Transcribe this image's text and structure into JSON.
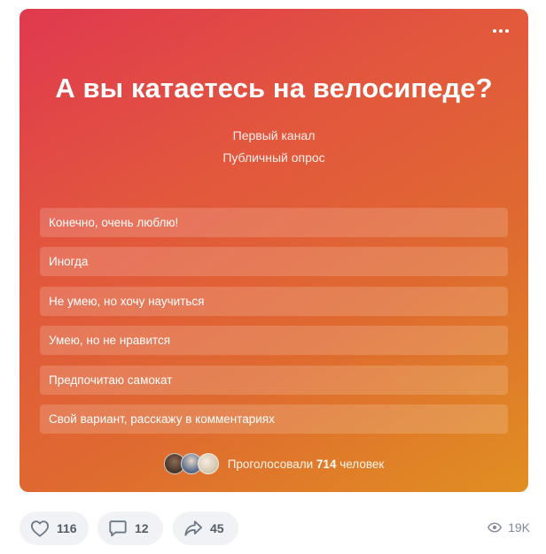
{
  "poll": {
    "title": "А вы катаетесь на велосипеде?",
    "author": "Первый канал",
    "type": "Публичный опрос",
    "options": [
      "Конечно, очень люблю!",
      "Иногда",
      "Не умею, но хочу научиться",
      "Умею, но не нравится",
      "Предпочитаю самокат",
      "Свой вариант, расскажу в комментариях"
    ],
    "voted_prefix": "Проголосовали",
    "voted_count": "714",
    "voted_suffix": "человек"
  },
  "actions": {
    "likes": "116",
    "comments": "12",
    "shares": "45",
    "views": "19K"
  },
  "icons": {
    "menu": "more-dots-icon",
    "like": "heart-icon",
    "comment": "comment-icon",
    "share": "share-arrow-icon",
    "views": "eye-icon"
  },
  "colors": {
    "gradient_start": "#e0394f",
    "gradient_end": "#e08f22",
    "button_bg": "#f0f2f5",
    "muted_text": "#818c99"
  }
}
